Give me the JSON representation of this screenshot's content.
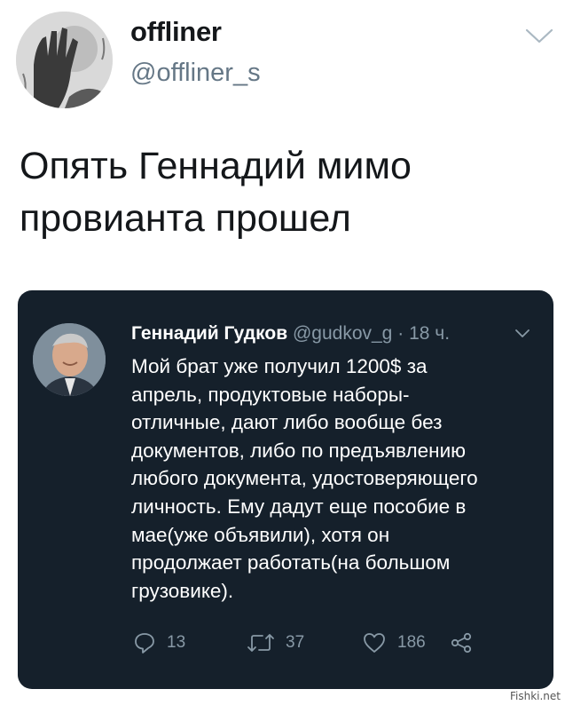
{
  "outer_tweet": {
    "display_name": "offliner",
    "handle": "@offliner_s",
    "text_lines": [
      "Опять Геннадий мимо",
      "провианта прошел"
    ],
    "avatar_icon": "user-avatar-hand-photo",
    "caret_icon": "chevron-down-icon"
  },
  "embedded_tweet": {
    "display_name": "Геннадий Гудков",
    "handle": "@gudkov_g",
    "separator": "·",
    "time": "18 ч.",
    "avatar_icon": "user-avatar-photo",
    "caret_icon": "chevron-down-icon",
    "text_lines": [
      "Мой брат уже получил 1200$ за",
      "апрель, продуктовые наборы-",
      "отличные, дают либо вообще без",
      "документов, либо по предъявлению",
      "любого документа, удостоверяющего",
      "личность. Ему дадут еще пособие в",
      "мае(уже объявили), хотя он",
      "продолжает работать(на большом",
      "грузовике)."
    ],
    "actions": {
      "reply_count": "13",
      "retweet_count": "37",
      "like_count": "186"
    },
    "background_color": "#15202b",
    "muted_color": "#8899a6"
  },
  "watermark": "Fishki.net"
}
